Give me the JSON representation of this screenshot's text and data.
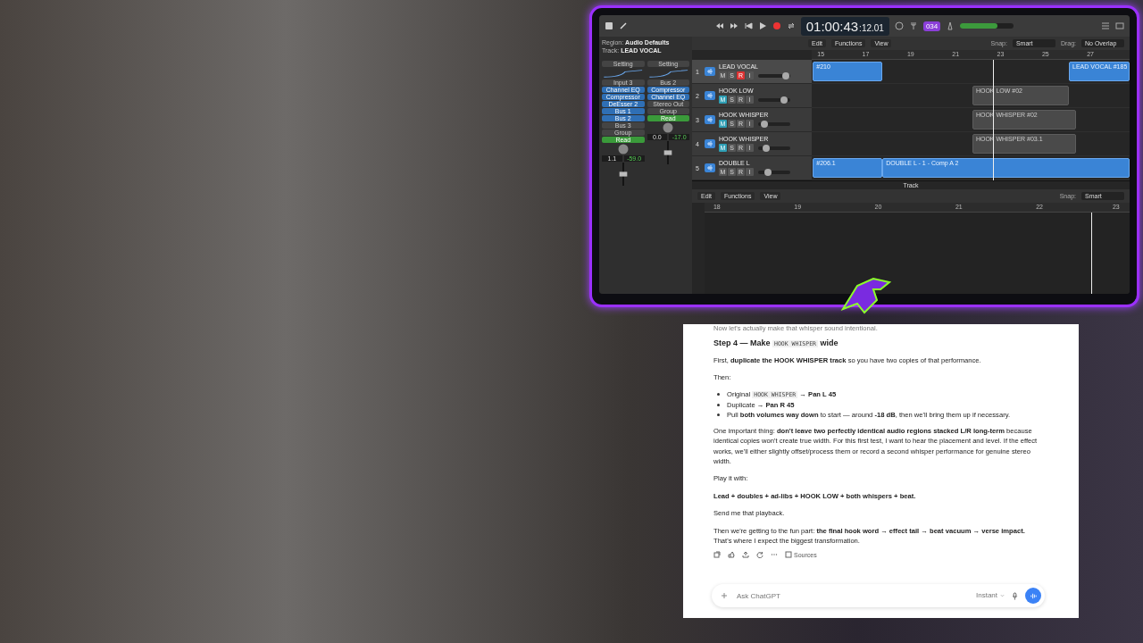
{
  "daw": {
    "timecode": {
      "main": "01:00:43",
      "sub": ":12.01"
    },
    "badge": "034",
    "master": {
      "level": 0.7
    },
    "inspector": {
      "region": {
        "label": "Region:",
        "value": "Audio Defaults"
      },
      "track": {
        "label": "Track:",
        "value": "LEAD VOCAL"
      },
      "strips": [
        {
          "setting": "Setting",
          "input": "Input 3",
          "plugins": [
            "Channel EQ",
            "Compressor",
            "DeEsser 2"
          ],
          "sends": [
            "Bus 1",
            "Bus 2"
          ],
          "output": "Bus 3",
          "group": "Group",
          "automation": "Read",
          "pan": "1.1",
          "gain": "-59.0"
        },
        {
          "setting": "Setting",
          "input": "Bus 2",
          "plugins": [
            "Compressor",
            "Channel EQ"
          ],
          "output": "Stereo Out",
          "group": "Group",
          "automation": "Read",
          "pan": "0.0",
          "gain": "-17.0"
        }
      ]
    },
    "menus": [
      "Edit",
      "Functions",
      "View"
    ],
    "snap": {
      "label": "Snap:",
      "value": "Smart"
    },
    "drag": {
      "label": "Drag:",
      "value": "No Overlap"
    },
    "ruler": [
      "15",
      "17",
      "19",
      "21",
      "23",
      "25",
      "27"
    ],
    "tracks": [
      {
        "number": "1",
        "name": "LEAD VOCAL",
        "selected": true,
        "level": 0.85,
        "buttons": [
          {
            "label": "M",
            "on": false
          },
          {
            "label": "S",
            "on": false
          },
          {
            "label": "R",
            "on": true
          },
          {
            "label": "I",
            "on": false
          }
        ],
        "regions": [
          "#210",
          "LEAD VOCAL #185"
        ]
      },
      {
        "number": "2",
        "name": "HOOK LOW",
        "selected": false,
        "level": 0.8,
        "buttons": [
          {
            "label": "M",
            "on": true
          },
          {
            "label": "S",
            "on": false
          },
          {
            "label": "R",
            "on": false
          },
          {
            "label": "I",
            "on": false
          }
        ],
        "regions": [
          "HOOK LOW #02"
        ]
      },
      {
        "number": "3",
        "name": "HOOK WHISPER",
        "selected": false,
        "level": 0.2,
        "buttons": [
          {
            "label": "M",
            "on": true
          },
          {
            "label": "S",
            "on": false
          },
          {
            "label": "R",
            "on": false
          },
          {
            "label": "I",
            "on": false
          }
        ],
        "regions": [
          "HOOK WHISPER #02"
        ]
      },
      {
        "number": "4",
        "name": "HOOK WHISPER",
        "selected": false,
        "level": 0.25,
        "buttons": [
          {
            "label": "M",
            "on": true
          },
          {
            "label": "S",
            "on": false
          },
          {
            "label": "R",
            "on": false
          },
          {
            "label": "I",
            "on": false
          }
        ],
        "regions": [
          "HOOK WHISPER #03.1"
        ]
      },
      {
        "number": "5",
        "name": "DOUBLE L",
        "selected": false,
        "level": 0.3,
        "buttons": [
          {
            "label": "M",
            "on": false
          },
          {
            "label": "S",
            "on": false
          },
          {
            "label": "R",
            "on": false
          },
          {
            "label": "I",
            "on": false
          }
        ],
        "regions": [
          "#206.1",
          "DOUBLE L - 1 - Comp A 2"
        ]
      }
    ],
    "editor": {
      "title": "Track",
      "menus": [
        "Edit",
        "Functions",
        "View"
      ],
      "snap": {
        "label": "Snap:",
        "value": "Smart"
      },
      "ruler": [
        "18",
        "19",
        "20",
        "21",
        "22",
        "23"
      ]
    }
  },
  "chat": {
    "blocks": [
      {
        "kind": "cut",
        "segments": [
          {
            "text": "Now let's actually make that whisper sound intentional."
          }
        ]
      },
      {
        "kind": "heading",
        "segments": [
          {
            "text": "Step 4 — Make "
          },
          {
            "code": "HOOK WHISPER"
          },
          {
            "text": " wide"
          }
        ]
      },
      {
        "kind": "text",
        "segments": [
          {
            "text": "First, "
          },
          {
            "bold": "duplicate the HOOK WHISPER track"
          },
          {
            "text": " so you have two copies of that performance."
          }
        ]
      },
      {
        "kind": "text",
        "segments": [
          {
            "text": "Then:"
          }
        ]
      },
      {
        "kind": "bullets",
        "items": [
          [
            {
              "text": "Original "
            },
            {
              "code": "HOOK WHISPER"
            },
            {
              "text": " → "
            },
            {
              "bold": "Pan L 45"
            }
          ],
          [
            {
              "text": "Duplicate → "
            },
            {
              "bold": "Pan R 45"
            }
          ],
          [
            {
              "text": "Pull "
            },
            {
              "bold": "both volumes way down"
            },
            {
              "text": " to start — around "
            },
            {
              "bold": "-18 dB"
            },
            {
              "text": ", then we'll bring them up if necessary."
            }
          ]
        ]
      },
      {
        "kind": "text",
        "segments": [
          {
            "text": "One important thing: "
          },
          {
            "bold": "don't leave two perfectly identical audio regions stacked L/R long-term"
          },
          {
            "text": " because identical copies won't create true width. For this first test, I want to hear the placement and level. If the effect works, we'll either slightly offset/process them or record a second whisper performance for genuine stereo width."
          }
        ]
      },
      {
        "kind": "text",
        "segments": [
          {
            "text": "Play it with:"
          }
        ]
      },
      {
        "kind": "text",
        "segments": [
          {
            "bold": "Lead + doubles + ad-libs + HOOK LOW + both whispers + beat."
          }
        ]
      },
      {
        "kind": "text",
        "segments": [
          {
            "text": "Send me that playback."
          }
        ]
      },
      {
        "kind": "text",
        "segments": [
          {
            "text": "Then we're getting to the fun part: "
          },
          {
            "bold": "the final hook word → effect tail → beat vacuum → verse impact."
          },
          {
            "text": " That's where I expect the biggest transformation."
          }
        ]
      }
    ],
    "sources": "Sources",
    "composer": {
      "placeholder": "Ask ChatGPT",
      "model": "Instant"
    }
  }
}
